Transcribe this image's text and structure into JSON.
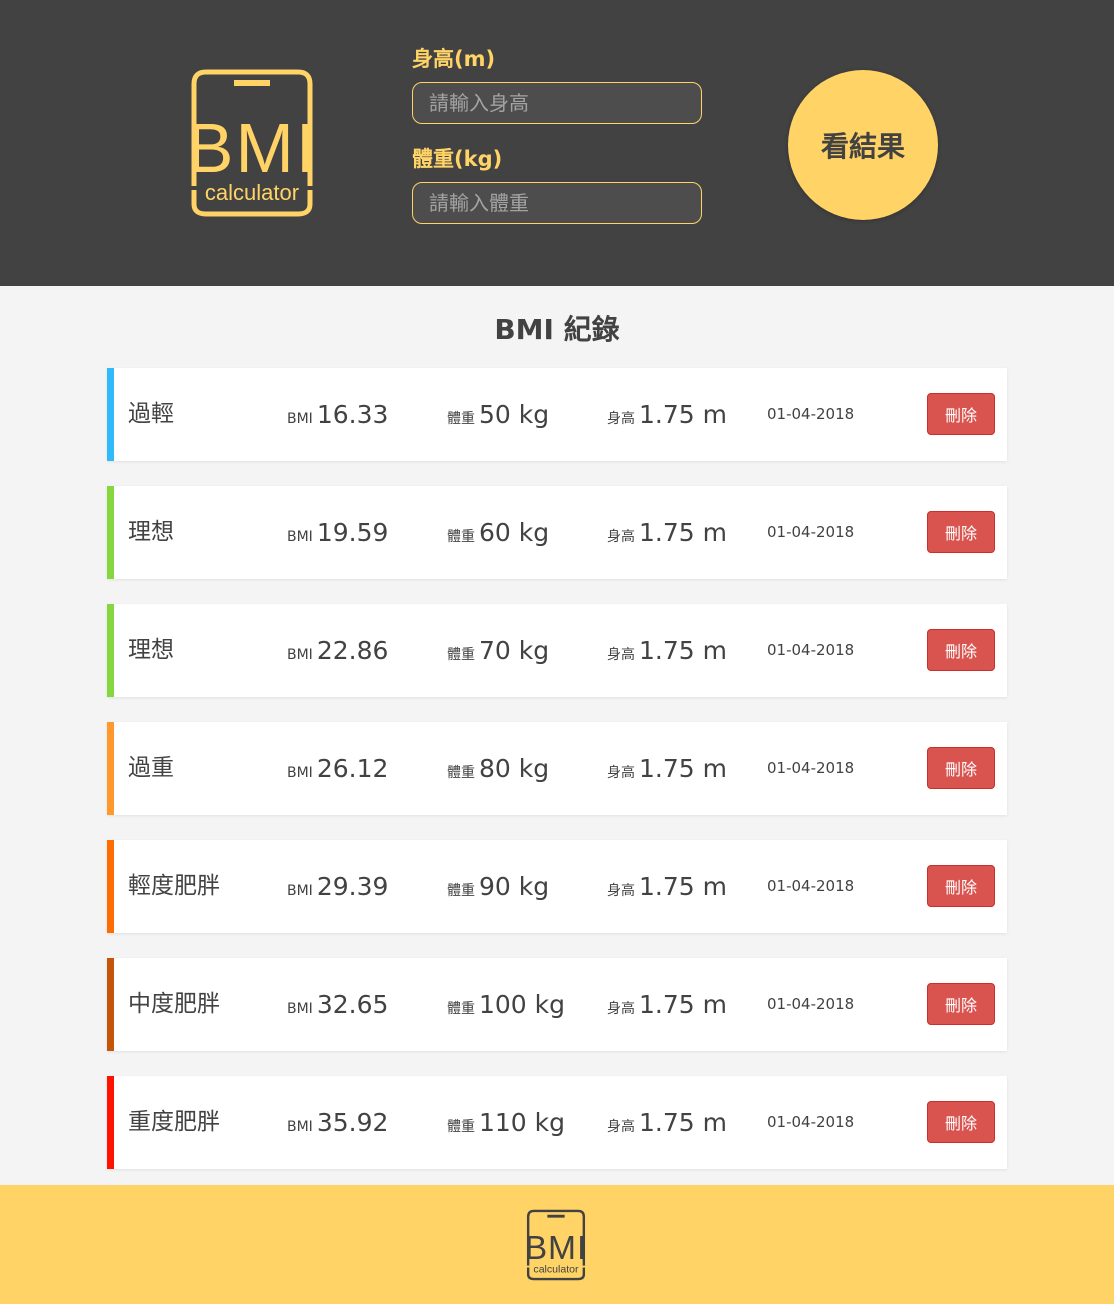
{
  "colors": {
    "header_bg": "#424242",
    "accent": "#ffd366",
    "page_bg": "#f4f4f4",
    "delete_button": "#d9534f"
  },
  "logo": {
    "main": "BMI",
    "sub": "calculator"
  },
  "form": {
    "height_label": "身高(m)",
    "height_placeholder": "請輸入身高",
    "weight_label": "體重(kg)",
    "weight_placeholder": "請輸入體重",
    "submit_label": "看結果"
  },
  "records_title": "BMI 紀錄",
  "labels": {
    "bmi": "BMI",
    "weight": "體重",
    "height": "身高",
    "delete": "刪除"
  },
  "records": [
    {
      "status": "過輕",
      "color": "#31baf9",
      "bmi": "16.33",
      "weight": "50",
      "weight_unit": "kg",
      "height": "1.75",
      "height_unit": "m",
      "date": "01-04-2018"
    },
    {
      "status": "理想",
      "color": "#86d73f",
      "bmi": "19.59",
      "weight": "60",
      "weight_unit": "kg",
      "height": "1.75",
      "height_unit": "m",
      "date": "01-04-2018"
    },
    {
      "status": "理想",
      "color": "#86d73f",
      "bmi": "22.86",
      "weight": "70",
      "weight_unit": "kg",
      "height": "1.75",
      "height_unit": "m",
      "date": "01-04-2018"
    },
    {
      "status": "過重",
      "color": "#ff982d",
      "bmi": "26.12",
      "weight": "80",
      "weight_unit": "kg",
      "height": "1.75",
      "height_unit": "m",
      "date": "01-04-2018"
    },
    {
      "status": "輕度肥胖",
      "color": "#ff6c02",
      "bmi": "29.39",
      "weight": "90",
      "weight_unit": "kg",
      "height": "1.75",
      "height_unit": "m",
      "date": "01-04-2018"
    },
    {
      "status": "中度肥胖",
      "color": "#c45509",
      "bmi": "32.65",
      "weight": "100",
      "weight_unit": "kg",
      "height": "1.75",
      "height_unit": "m",
      "date": "01-04-2018"
    },
    {
      "status": "重度肥胖",
      "color": "#ff1200",
      "bmi": "35.92",
      "weight": "110",
      "weight_unit": "kg",
      "height": "1.75",
      "height_unit": "m",
      "date": "01-04-2018"
    }
  ],
  "footer_logo": {
    "main": "BMI",
    "sub": "calculator"
  }
}
